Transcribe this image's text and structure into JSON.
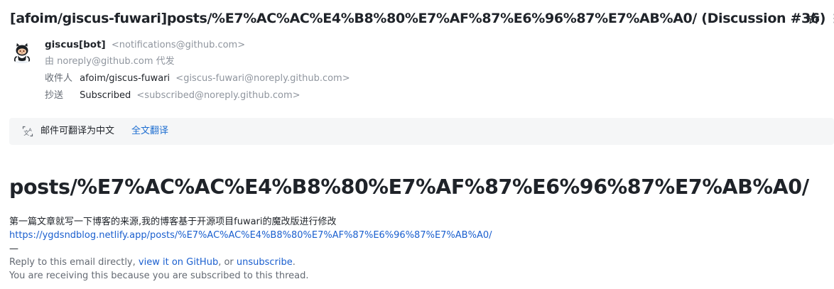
{
  "subject": "[afoim/giscus-fuwari]posts/%E7%AC%AC%E4%B8%80%E7%AF%87%E6%96%87%E7%AB%A0/ (Discussion #36)",
  "header": {
    "sender_name": "giscus[bot]",
    "sender_email": "<notifications@github.com>",
    "via_line": "由 noreply@github.com 代发",
    "to_label": "收件人",
    "to_name": "afoim/giscus-fuwari",
    "to_email": "<giscus-fuwari@noreply.github.com>",
    "cc_label": "抄送",
    "cc_name": "Subscribed",
    "cc_email": "<subscribed@noreply.github.com>"
  },
  "translate": {
    "notice": "邮件可翻译为中文",
    "action": "全文翻译"
  },
  "body": {
    "title": "posts/%E7%AC%AC%E4%B8%80%E7%AF%87%E6%96%87%E7%AB%A0/",
    "description": "第一篇文章就写一下博客的来源,我的博客基于开源项目fuwari的魔改版进行修改",
    "url": "https://ygdsndblog.netlify.app/posts/%E7%AC%AC%E4%B8%80%E7%AF%87%E6%96%87%E7%AB%A0/",
    "separator": "—",
    "reply_prefix": "Reply to this email directly, ",
    "view_link": "view it on GitHub",
    "reply_middle": ", or ",
    "unsubscribe_link": "unsubscribe",
    "reply_suffix": ".",
    "receiving_note": "You are receiving this because you are subscribed to this thread."
  },
  "icons": {
    "avatar": "github-octocat-icon",
    "star": "star-icon",
    "more": "more-icon",
    "translate": "translate-icon"
  }
}
